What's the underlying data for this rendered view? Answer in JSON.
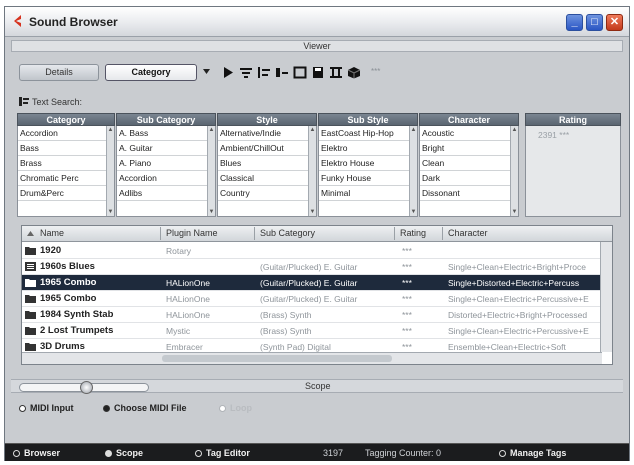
{
  "window": {
    "title": "Sound Browser",
    "accent": "#d6321e",
    "minimize_glyph": "_",
    "maximize_glyph": "□",
    "close_glyph": "✕"
  },
  "viewer": {
    "label": "Viewer",
    "tabs": [
      {
        "label": "Details",
        "active": false
      },
      {
        "label": "Category",
        "active": true
      }
    ],
    "toolbar_icons": [
      "play-icon",
      "list-icon",
      "columns-icon",
      "filter-icon",
      "frame-icon",
      "save-icon",
      "grid-icon",
      "cube-icon"
    ],
    "extra_marker": "***",
    "text_search_label": "Text Search:"
  },
  "filters": [
    {
      "header": "Category",
      "items": [
        "Accordion",
        "Bass",
        "Brass",
        "Chromatic Perc",
        "Drum&Perc"
      ]
    },
    {
      "header": "Sub Category",
      "items": [
        "A. Bass",
        "A. Guitar",
        "A. Piano",
        "Accordion",
        "Adlibs"
      ]
    },
    {
      "header": "Style",
      "items": [
        "Alternative/Indie",
        "Ambient/ChillOut",
        "Blues",
        "Classical",
        "Country"
      ]
    },
    {
      "header": "Sub Style",
      "items": [
        "EastCoast Hip-Hop",
        "Elektro",
        "Elektro House",
        "Funky House",
        "Minimal"
      ]
    },
    {
      "header": "Character",
      "items": [
        "Acoustic",
        "Bright",
        "Clean",
        "Dark",
        "Dissonant"
      ]
    },
    {
      "header": "Rating",
      "value": "2391 ***"
    }
  ],
  "results": {
    "columns": [
      "Name",
      "Plugin Name",
      "Sub Category",
      "Rating",
      "Character"
    ],
    "rows": [
      {
        "icon": "folder-icon",
        "name": "1920",
        "plugin": "Rotary",
        "subcat": "",
        "rating": "***",
        "character": "",
        "selected": false
      },
      {
        "icon": "list-icon",
        "name": "1960s Blues",
        "plugin": "",
        "subcat": "(Guitar/Plucked) E. Guitar",
        "rating": "***",
        "character": "Single+Clean+Electric+Bright+Proce",
        "selected": false
      },
      {
        "icon": "folder-icon",
        "name": "1965 Combo",
        "plugin": "HALionOne",
        "subcat": "(Guitar/Plucked) E. Guitar",
        "rating": "***",
        "character": "Single+Distorted+Electric+Percuss",
        "selected": true
      },
      {
        "icon": "folder-icon",
        "name": "1965 Combo",
        "plugin": "HALionOne",
        "subcat": "(Guitar/Plucked) E. Guitar",
        "rating": "***",
        "character": "Single+Clean+Electric+Percussive+E",
        "selected": false
      },
      {
        "icon": "folder-icon",
        "name": "1984 Synth Stab",
        "plugin": "HALionOne",
        "subcat": "(Brass) Synth",
        "rating": "***",
        "character": "Distorted+Electric+Bright+Processed",
        "selected": false
      },
      {
        "icon": "folder-icon",
        "name": "2 Lost Trumpets",
        "plugin": "Mystic",
        "subcat": "(Brass) Synth",
        "rating": "***",
        "character": "Single+Clean+Electric+Percussive+E",
        "selected": false
      },
      {
        "icon": "folder-icon",
        "name": "3D Drums",
        "plugin": "Embracer",
        "subcat": "(Synth Pad) Digital",
        "rating": "***",
        "character": "Ensemble+Clean+Electric+Soft",
        "selected": false
      }
    ]
  },
  "scope": {
    "label": "Scope",
    "options": [
      {
        "label": "MIDI Input",
        "selected": false
      },
      {
        "label": "Choose MIDI File",
        "selected": true
      },
      {
        "label": "Loop",
        "selected": false
      }
    ]
  },
  "statusbar": {
    "browser": "Browser",
    "scope": "Scope",
    "tag_editor": "Tag Editor",
    "count": "3197",
    "tagging_counter": "Tagging Counter: 0",
    "manage_tags": "Manage Tags"
  }
}
